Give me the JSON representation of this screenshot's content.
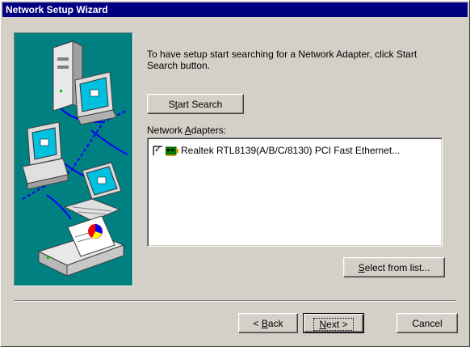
{
  "window": {
    "title": "Network Setup Wizard"
  },
  "instructions": {
    "line1": "To have setup start searching for a Network Adapter, click Start",
    "line2": "Search button."
  },
  "buttons": {
    "start_search": {
      "before": "S",
      "mnemonic": "t",
      "after": "art Search"
    },
    "select_from_list": {
      "before": "",
      "mnemonic": "S",
      "after": "elect from list..."
    },
    "back": {
      "before": "< ",
      "mnemonic": "B",
      "after": "ack"
    },
    "next": {
      "before": "",
      "mnemonic": "N",
      "after": "ext >"
    },
    "cancel": {
      "label": "Cancel"
    }
  },
  "adapters": {
    "label_before": "Network ",
    "label_mnemonic": "A",
    "label_after": "dapters:",
    "items": [
      {
        "label": "Realtek RTL8139(A/B/C/8130) PCI Fast Ethernet...",
        "checked": true,
        "icon": "network-card-icon"
      }
    ]
  },
  "colors": {
    "titlebar": "#000080",
    "illustration_bg": "#008080",
    "face": "#d4d0c8"
  }
}
